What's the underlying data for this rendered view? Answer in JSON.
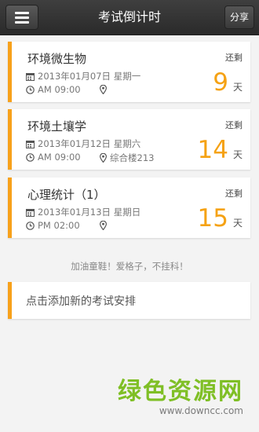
{
  "header": {
    "title": "考试倒计时",
    "share_label": "分享"
  },
  "exams": [
    {
      "name": "环境微生物",
      "remain_label": "还剩",
      "date": "2013年01月07日 星期一",
      "time": "AM 09:00",
      "location": "",
      "days": "9",
      "days_unit": "天"
    },
    {
      "name": "环境土壤学",
      "remain_label": "还剩",
      "date": "2013年01月12日 星期六",
      "time": "AM 09:00",
      "location": "综合楼213",
      "days": "14",
      "days_unit": "天"
    },
    {
      "name": "心理统计（1）",
      "remain_label": "还剩",
      "date": "2013年01月13日 星期日",
      "time": "PM 02:00",
      "location": "",
      "days": "15",
      "days_unit": "天"
    }
  ],
  "motto": "加油童鞋！爱格子，不挂科！",
  "add_label": "点击添加新的考试安排",
  "watermark": {
    "title": "绿色资源网",
    "url": "www.downcc.com"
  },
  "colors": {
    "accent": "#f7a11b",
    "header_bg": "#333333",
    "watermark": "#7fbf25"
  }
}
